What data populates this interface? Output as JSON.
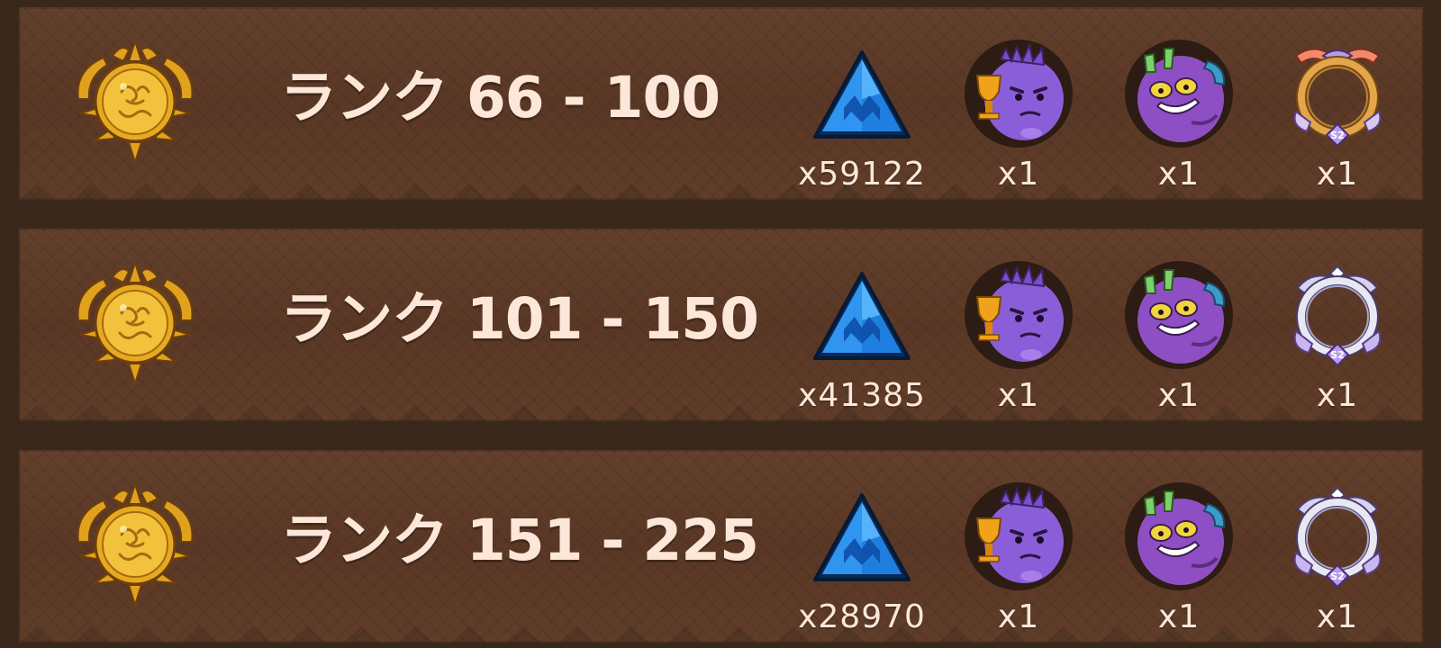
{
  "tiers": [
    {
      "title": "ランク 66 - 100",
      "rewards": {
        "crystal_qty": "x59122",
        "avatar_trophy_qty": "x1",
        "avatar_grin_qty": "x1",
        "frame_qty": "x1"
      },
      "frame_style": "gold",
      "frame_badge": "S2"
    },
    {
      "title": "ランク 101 - 150",
      "rewards": {
        "crystal_qty": "x41385",
        "avatar_trophy_qty": "x1",
        "avatar_grin_qty": "x1",
        "frame_qty": "x1"
      },
      "frame_style": "silver",
      "frame_badge": "S2"
    },
    {
      "title": "ランク 151 - 225",
      "rewards": {
        "crystal_qty": "x28970",
        "avatar_trophy_qty": "x1",
        "avatar_grin_qty": "x1",
        "frame_qty": "x1"
      },
      "frame_style": "silver",
      "frame_badge": "S2"
    }
  ],
  "icons": {
    "emblem": "golden-sun-emblem-icon",
    "crystal": "blue-crystal-icon",
    "avatar_trophy": "purple-monster-trophy-avatar-icon",
    "avatar_grin": "purple-monster-grin-avatar-icon",
    "frame": "avatar-frame-icon"
  },
  "colors": {
    "row_background": "#5d3a27",
    "page_background": "#3a271c",
    "title_text": "#fde7d8",
    "emblem_gold": "#e0a21e",
    "crystal_blue": "#1f7fe0",
    "monster_purple": "#8a5ed8"
  }
}
